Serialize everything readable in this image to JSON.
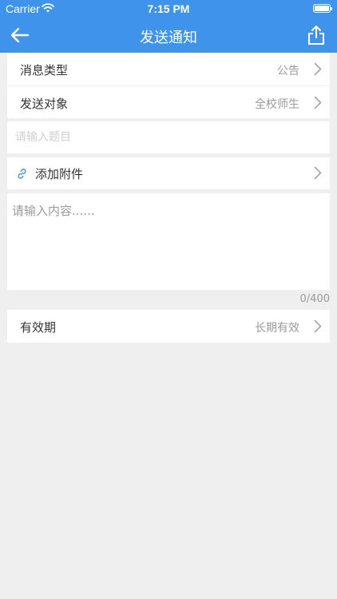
{
  "status_bar": {
    "carrier": "Carrier",
    "time": "7:15 PM"
  },
  "nav": {
    "title": "发送通知"
  },
  "form": {
    "message_type": {
      "label": "消息类型",
      "value": "公告"
    },
    "recipients": {
      "label": "发送对象",
      "value": "全校师生"
    },
    "title_placeholder": "请输入题目",
    "attachment": {
      "label": "添加附件"
    },
    "content_placeholder": "请输入内容......",
    "char_count": "0/400",
    "validity": {
      "label": "有效期",
      "value": "长期有效"
    }
  },
  "colors": {
    "primary": "#3f93ea",
    "background": "#efefef",
    "link_icon": "#3f93ea"
  },
  "icons": [
    "back-arrow-icon",
    "share-icon",
    "chevron-right-icon",
    "link-icon",
    "wifi-icon",
    "battery-icon"
  ]
}
